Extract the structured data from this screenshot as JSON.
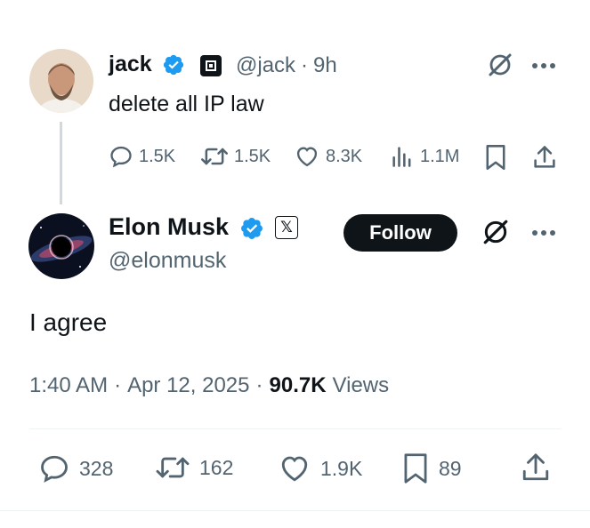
{
  "parent_tweet": {
    "name": "jack",
    "handle": "@jack",
    "separator": "·",
    "time": "9h",
    "text": "delete all IP law",
    "replies": "1.5K",
    "reposts": "1.5K",
    "likes": "8.3K",
    "views": "1.1M"
  },
  "main_tweet": {
    "name": "Elon Musk",
    "handle": "@elonmusk",
    "follow_label": "Follow",
    "text": "I agree",
    "time": "1:40 AM",
    "date": "Apr 12, 2025",
    "separator": "·",
    "views_count": "90.7K",
    "views_label": "Views",
    "replies": "328",
    "reposts": "162",
    "likes": "1.9K",
    "bookmarks": "89",
    "badge_letter": "𝕏"
  },
  "colors": {
    "verified": "#1d9bf0",
    "text": "#0f1419",
    "muted": "#536471",
    "divider": "#eff3f4"
  }
}
